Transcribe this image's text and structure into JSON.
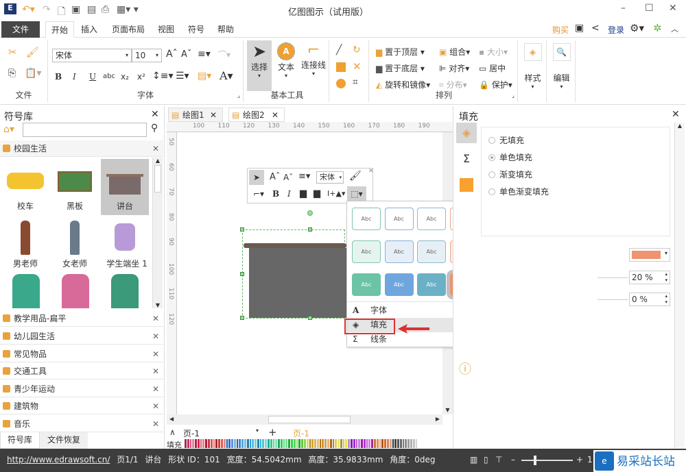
{
  "app": {
    "title": "亿图图示（试用版）"
  },
  "menu": {
    "tabs": [
      "文件",
      "开始",
      "插入",
      "页面布局",
      "视图",
      "符号",
      "帮助"
    ],
    "active": "开始",
    "buy": "购买",
    "login": "登录"
  },
  "ribbon": {
    "groups": {
      "file": "文件",
      "font": "字体",
      "basic_tools": "基本工具",
      "arrange": "排列"
    },
    "font_name": "宋体",
    "font_size": "10",
    "tools": {
      "select": "选择",
      "text": "文本",
      "connector": "连接线"
    },
    "arrange": {
      "bring_front": "置于顶层",
      "send_back": "置于底层",
      "rotate": "旋转和镜像",
      "group": "组合",
      "align": "对齐",
      "distribute": "分布",
      "size": "大小",
      "center": "居中",
      "protect": "保护"
    },
    "style": "样式",
    "edit": "编辑"
  },
  "library": {
    "title": "符号库",
    "search_value": "",
    "open_category": "校园生活",
    "symbols": [
      "校车",
      "黑板",
      "讲台",
      "男老师",
      "女老师",
      "学生端坐 1"
    ],
    "categories": [
      "教学用品-扁平",
      "幼儿园生活",
      "常见物品",
      "交通工具",
      "青少年运动",
      "建筑物",
      "音乐"
    ],
    "bottom_tabs": [
      "符号库",
      "文件恢复"
    ]
  },
  "documents": {
    "tabs": [
      "绘图1",
      "绘图2"
    ],
    "active": "绘图2"
  },
  "ruler": {
    "top": [
      "100",
      "110",
      "120",
      "130",
      "140",
      "150",
      "160",
      "170",
      "180",
      "190"
    ],
    "left": [
      "50",
      "60",
      "70",
      "80",
      "90",
      "100",
      "110",
      "120"
    ]
  },
  "minitoolbar": {
    "font": "宋体"
  },
  "popup": {
    "swatches": [
      {
        "bg": "#ffffff",
        "border": "#7fc4b0"
      },
      {
        "bg": "#ffffff",
        "border": "#8ab0d8"
      },
      {
        "bg": "#ffffff",
        "border": "#88bccc"
      },
      {
        "bg": "#ffffff",
        "border": "#e8a988"
      },
      {
        "bg": "#ffffff",
        "border": "#f0cc8c"
      },
      {
        "bg": "#ffffff",
        "border": "#e0a8b8"
      },
      {
        "bg": "#ffffff",
        "border": "#8c98a8"
      },
      {
        "bg": "#e6f4ef",
        "border": "#7fc4b0"
      },
      {
        "bg": "#e6eef8",
        "border": "#8ab0d8"
      },
      {
        "bg": "#e6f0f4",
        "border": "#88bccc"
      },
      {
        "bg": "#fbece4",
        "border": "#e8a988"
      },
      {
        "bg": "#fdf3e4",
        "border": "#f0cc8c"
      },
      {
        "bg": "#fae8ee",
        "border": "#e0a8b8"
      },
      {
        "bg": "#e8ecf0",
        "border": "#8c98a8"
      },
      {
        "bg": "#6cc3a6",
        "border": "#6cc3a6"
      },
      {
        "bg": "#6fa6de",
        "border": "#6fa6de"
      },
      {
        "bg": "#6cb0c8",
        "border": "#6cb0c8"
      },
      {
        "bg": "#ee9470",
        "border": "#ee9470"
      },
      {
        "bg": "#f5bf6c",
        "border": "#f5bf6c"
      },
      {
        "bg": "#e08aa2",
        "border": "#e08aa2"
      },
      {
        "bg": "#7d8ca4",
        "border": "#7d8ca4"
      }
    ],
    "swatch_label": "Abc",
    "selected_index": 17,
    "menu": [
      "字体",
      "填充",
      "线条"
    ],
    "highlighted": "填充"
  },
  "fill_panel": {
    "title": "填充",
    "options": [
      "无填充",
      "单色填充",
      "渐变填充",
      "单色渐变填充"
    ],
    "selected": "单色填充",
    "color": "#ee9470",
    "transparency": "20 %",
    "brightness": "0 %"
  },
  "pagebar": {
    "page_select": "页-1",
    "page_tab": "页-1",
    "fill_label": "填充"
  },
  "status": {
    "url": "http://www.edrawsoft.cn/",
    "page": "页1/1",
    "shape": "讲台",
    "shape_id": "形状 ID：101",
    "width": "宽度：54.5042mm",
    "height": "高度：35.9833mm",
    "angle": "角度：0deg",
    "zoom_prefix": "1"
  },
  "watermark": {
    "text": "易采站长站"
  },
  "colors": {
    "accent": "#f0a030",
    "dark": "#474747",
    "selection_red": "#e03030"
  }
}
